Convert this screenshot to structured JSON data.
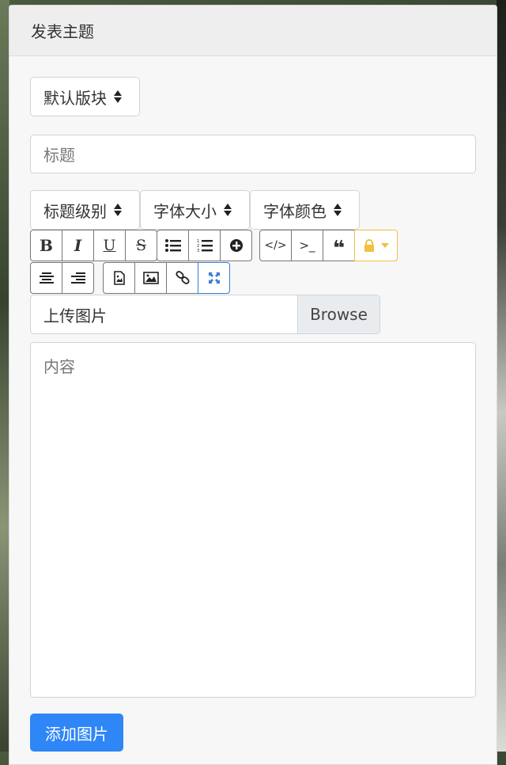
{
  "header": {
    "title": "发表主题"
  },
  "forum_select": {
    "value": "默认版块"
  },
  "title_input": {
    "placeholder": "标题"
  },
  "format_selects": {
    "heading_level": "标题级别",
    "font_size": "字体大小",
    "font_color": "字体颜色"
  },
  "toolbar": {
    "bold": "B",
    "italic": "I",
    "underline": "U",
    "strike": "S",
    "code": "</>",
    "terminal": ">_",
    "quote": "❝",
    "icons": [
      "bold-icon",
      "italic-icon",
      "underline-icon",
      "strikethrough-icon",
      "unordered-list-icon",
      "ordered-list-icon",
      "add-circle-icon",
      "code-icon",
      "terminal-icon",
      "quote-icon",
      "lock-icon",
      "align-center-icon",
      "align-right-icon",
      "file-image-icon",
      "image-icon",
      "link-icon",
      "fullscreen-icon"
    ]
  },
  "upload": {
    "label": "上传图片",
    "browse": "Browse"
  },
  "content": {
    "placeholder": "内容"
  },
  "add_image_button": {
    "label": "添加图片"
  },
  "colors": {
    "primary": "#2f86f6",
    "warning": "#f0c040",
    "active": "#3a7bd5"
  }
}
